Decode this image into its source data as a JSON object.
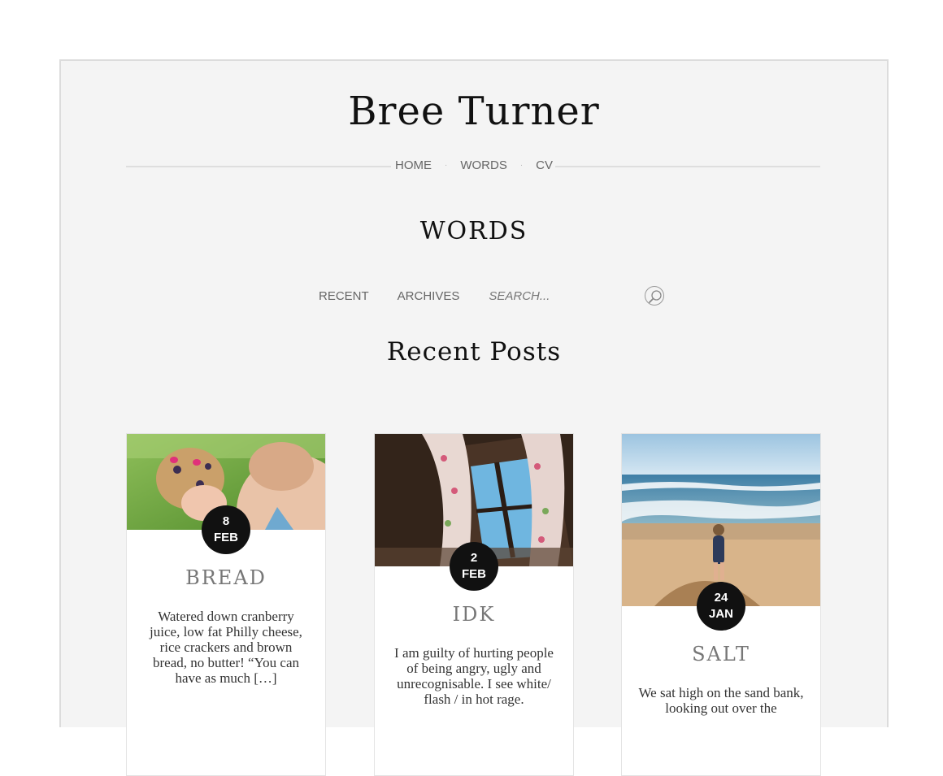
{
  "site": {
    "title": "Bree Turner"
  },
  "nav": {
    "items": [
      {
        "label": "HOME"
      },
      {
        "label": "WORDS"
      },
      {
        "label": "CV"
      }
    ]
  },
  "page": {
    "title": "WORDS"
  },
  "subnav": {
    "recent_label": "RECENT",
    "archives_label": "ARCHIVES",
    "search_placeholder": "SEARCH..."
  },
  "section": {
    "title": "Recent Posts"
  },
  "posts": [
    {
      "day": "8",
      "month": "FEB",
      "title": "BREAD",
      "excerpt": "Watered down cranberry juice, low fat Philly cheese, rice crackers and brown bread, no butter! “You can have as much […]"
    },
    {
      "day": "2",
      "month": "FEB",
      "title": "IDK",
      "excerpt": "I am guilty of hurting people of being angry, ugly and unrecognisable. I see white/ flash / in hot rage."
    },
    {
      "day": "24",
      "month": "JAN",
      "title": "SALT",
      "excerpt": "We sat high on the sand bank, looking out over the"
    }
  ]
}
